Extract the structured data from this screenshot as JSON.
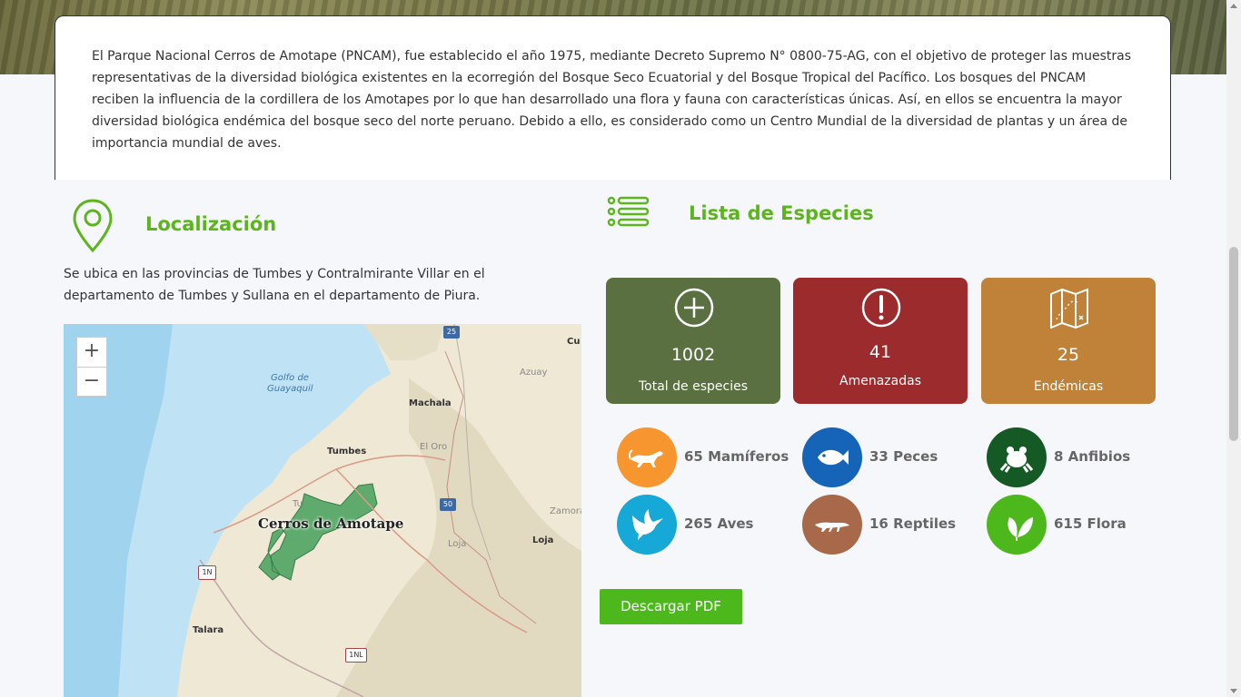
{
  "intro": {
    "text": "El Parque Nacional Cerros de Amotape (PNCAM), fue establecido el año 1975, mediante Decreto Supremo N° 0800-75-AG, con el objetivo de proteger las muestras representativas de la diversidad biológica existentes en la ecorregión del Bosque Seco Ecuatorial y del Bosque Tropical del Pacífico. Los bosques del PNCAM reciben la influencia de la cordillera de los Amotapes por lo que han desarrollado una flora y fauna con características únicas. Así, en ellos se encuentra la mayor diversidad biológica endémica del bosque seco del norte peruano. Debido a ello, es considerado como un Centro Mundial de la diversidad de plantas y un área de importancia mundial de aves."
  },
  "location": {
    "title": "Localización",
    "text": "Se ubica en las provincias de Tumbes y Contralmirante Villar en el departamento de Tumbes y Sullana en el departamento de Piura.",
    "map": {
      "zoom_in": "+",
      "zoom_out": "−",
      "labels": {
        "golfo": "Golfo de",
        "guayaquil": "Guayaquil",
        "machala": "Machala",
        "azuay": "Azuay",
        "cu": "Cu",
        "tumbes": "Tumbes",
        "el_oro": "El Oro",
        "tu": "Tu",
        "park": "Cerros de Amotape",
        "zamora": "Zamora",
        "loja_gray": "Loja",
        "loja": "Loja",
        "talara": "Talara"
      },
      "shields": {
        "r25": "25",
        "r50": "50",
        "r1n": "1N",
        "r1nl": "1NL"
      }
    }
  },
  "species": {
    "title": "Lista de Especies",
    "stats": [
      {
        "value": "1002",
        "label": "Total de especies",
        "color": "#5a7040",
        "icon": "plus-circle-icon"
      },
      {
        "value": "41",
        "label": "Amenazadas",
        "color": "#9b2b2d",
        "icon": "exclamation-circle-icon"
      },
      {
        "value": "25",
        "label": "Endémicas",
        "color": "#bf8238",
        "icon": "map-icon"
      }
    ],
    "groups": [
      {
        "label": "65 Mamíferos",
        "color": "#f7962f",
        "icon": "puma-icon"
      },
      {
        "label": "33 Peces",
        "color": "#1564b8",
        "icon": "fish-icon"
      },
      {
        "label": "8 Anfibios",
        "color": "#155a24",
        "icon": "frog-icon"
      },
      {
        "label": "265 Aves",
        "color": "#16a8d6",
        "icon": "bird-icon"
      },
      {
        "label": "16 Reptiles",
        "color": "#a8694a",
        "icon": "crocodile-icon"
      },
      {
        "label": "615 Flora",
        "color": "#4cb81c",
        "icon": "leaf-icon"
      }
    ],
    "download_label": "Descargar PDF"
  }
}
